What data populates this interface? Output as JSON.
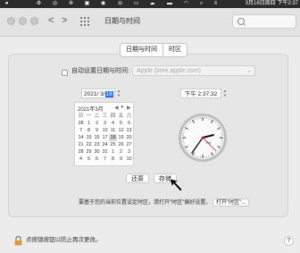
{
  "menubar": {
    "datetime": "3月18日周四 下午2:37"
  },
  "toolbar": {
    "back_glyph": "<",
    "forward_glyph": ">",
    "title": "日期与时间",
    "search_placeholder": ""
  },
  "tabs": [
    {
      "label": "日期与时间"
    },
    {
      "label": "时区"
    }
  ],
  "auto_time": {
    "label": "自动设置日期与时间:",
    "server": "Apple (time.apple.com)",
    "checked": false
  },
  "date": {
    "prefix": "2021/ 3/",
    "day": "18"
  },
  "time": {
    "value": "下午 2:37:32"
  },
  "calendar": {
    "title": "2021年3月",
    "weekdays": [
      "日",
      "一",
      "二",
      "三",
      "四",
      "五",
      "六"
    ],
    "weeks": [
      [
        "28",
        "1",
        "2",
        "3",
        "4",
        "5",
        "6"
      ],
      [
        "7",
        "8",
        "9",
        "10",
        "11",
        "12",
        "13"
      ],
      [
        "14",
        "15",
        "16",
        "17",
        "18",
        "19",
        "20"
      ],
      [
        "21",
        "22",
        "23",
        "24",
        "25",
        "26",
        "27"
      ],
      [
        "28",
        "29",
        "30",
        "31",
        "1",
        "2",
        "3"
      ],
      [
        "4",
        "5",
        "6",
        "7",
        "8",
        "9",
        "10"
      ]
    ],
    "selected": "18"
  },
  "clock": {
    "period": "PM"
  },
  "buttons": {
    "revert": "还原",
    "apply": "存储"
  },
  "hint": {
    "text": "要基于您的当前位置设定时区，请打开\"时区\"偏好设置。",
    "button": "打开\"时区\"..."
  },
  "footer": {
    "lock_text": "点按锁按钮以防止再次更改。",
    "help": "?"
  }
}
